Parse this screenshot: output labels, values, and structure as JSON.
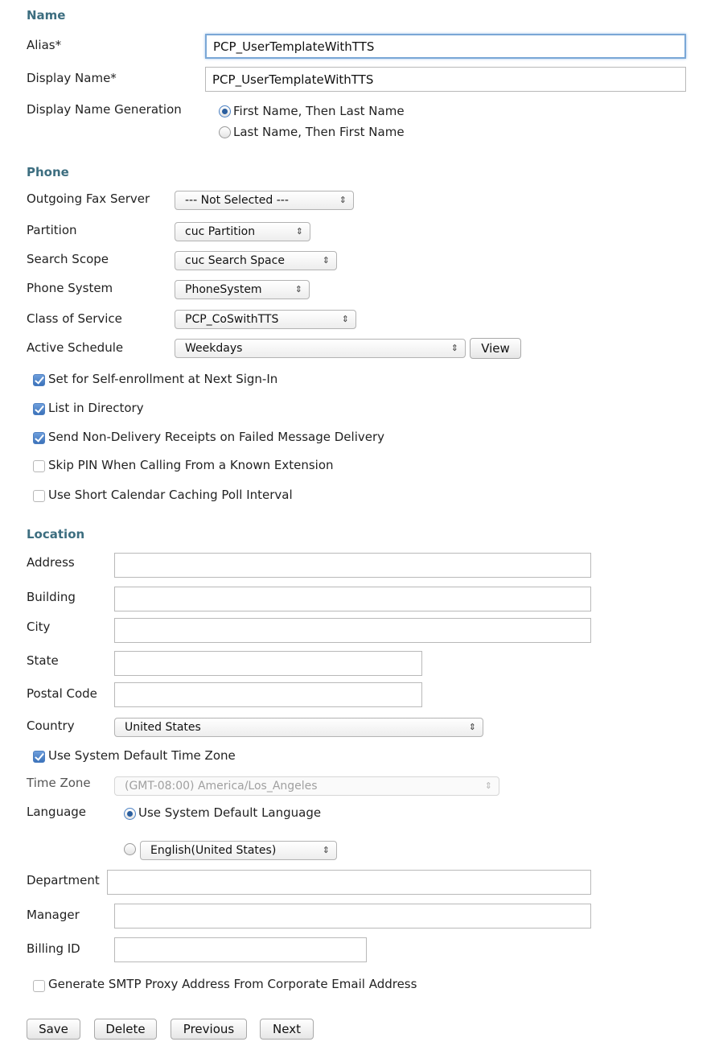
{
  "name_section": {
    "title": "Name",
    "alias_label": "Alias*",
    "alias_value": "PCP_UserTemplateWithTTS",
    "display_name_label": "Display Name*",
    "display_name_value": "PCP_UserTemplateWithTTS",
    "generation_label": "Display Name Generation",
    "generation_options": [
      "First Name, Then Last Name",
      "Last Name, Then First Name"
    ],
    "generation_selected": "First Name, Then Last Name"
  },
  "phone_section": {
    "title": "Phone",
    "outgoing_fax_label": "Outgoing Fax Server",
    "outgoing_fax_value": "--- Not Selected ---",
    "partition_label": "Partition",
    "partition_value": "cuc Partition",
    "search_scope_label": "Search Scope",
    "search_scope_value": "cuc Search Space",
    "phone_system_label": "Phone System",
    "phone_system_value": "PhoneSystem",
    "cos_label": "Class of Service",
    "cos_value": "PCP_CoSwithTTS",
    "schedule_label": "Active Schedule",
    "schedule_value": "Weekdays",
    "view_button": "View",
    "checkboxes": [
      {
        "label": "Set for Self-enrollment at Next Sign-In",
        "checked": true
      },
      {
        "label": "List in Directory",
        "checked": true
      },
      {
        "label": "Send Non-Delivery Receipts on Failed Message Delivery",
        "checked": true
      },
      {
        "label": "Skip PIN When Calling From a Known Extension",
        "checked": false
      },
      {
        "label": "Use Short Calendar Caching Poll Interval",
        "checked": false
      }
    ]
  },
  "location_section": {
    "title": "Location",
    "address_label": "Address",
    "address_value": "",
    "building_label": "Building",
    "building_value": "",
    "city_label": "City",
    "city_value": "",
    "state_label": "State",
    "state_value": "",
    "postal_label": "Postal Code",
    "postal_value": "",
    "country_label": "Country",
    "country_value": "United States",
    "tz_default_label": "Use System Default Time Zone",
    "tz_default_checked": true,
    "timezone_label": "Time Zone",
    "timezone_value": "(GMT-08:00) America/Los_Angeles",
    "timezone_disabled": true,
    "language_label": "Language",
    "language_default_option": "Use System Default Language",
    "language_default_selected": true,
    "language_select_value": "English(United States)",
    "department_label": "Department",
    "department_value": "",
    "manager_label": "Manager",
    "manager_value": "",
    "billing_label": "Billing ID",
    "billing_value": "",
    "smtp_label": "Generate SMTP Proxy Address From Corporate Email Address",
    "smtp_checked": false
  },
  "buttons": {
    "save": "Save",
    "delete": "Delete",
    "previous": "Previous",
    "next": "Next"
  },
  "colors": {
    "section_heading": "#3d6e80",
    "focus_border": "#7aa7d6",
    "checkbox_checked": "#3b72ba"
  }
}
